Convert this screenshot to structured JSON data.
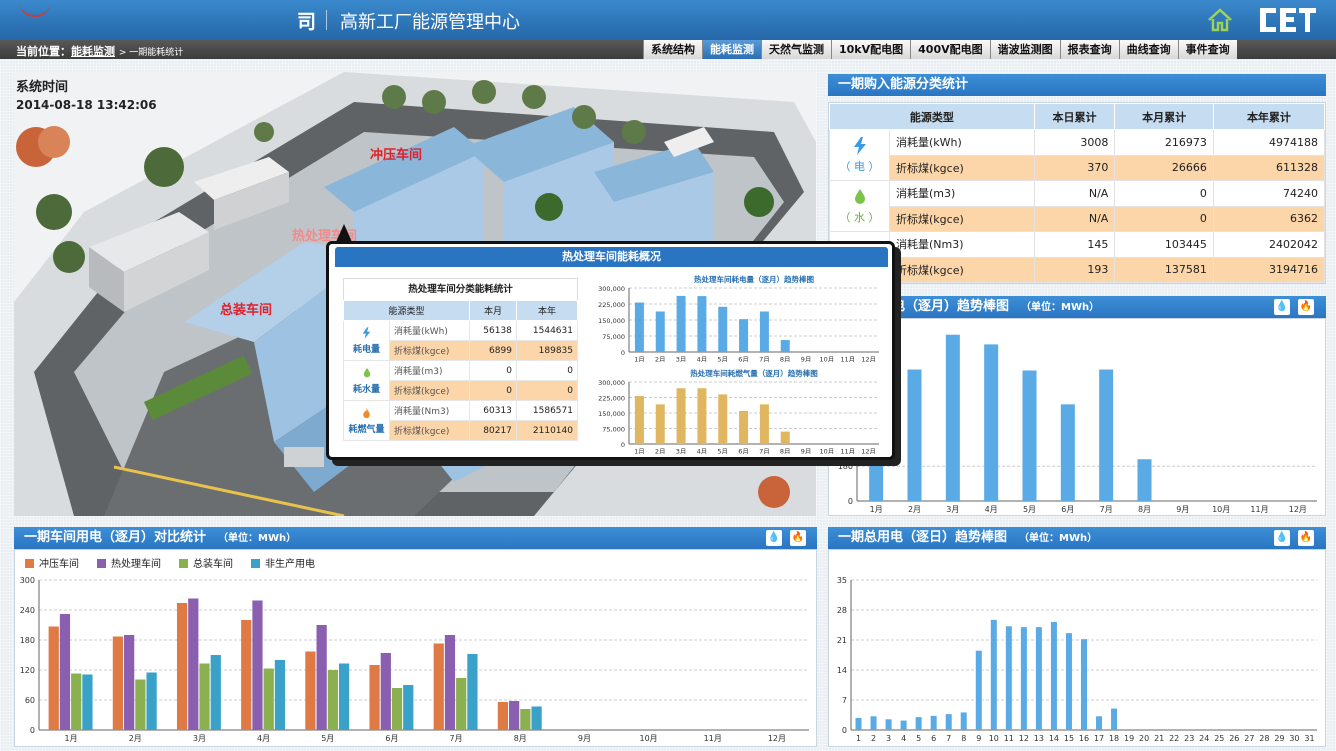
{
  "header": {
    "org_logo_text": "司",
    "title": "高新工厂能源管理中心",
    "home_icon": "home-icon",
    "brand_text": "CET"
  },
  "breadcrumb": {
    "prefix": "当前位置：",
    "current": "能耗监测",
    "sub": "> 一期能耗统计"
  },
  "menu": [
    "系统结构",
    "能耗监测",
    "天然气监测",
    "10kV配电图",
    "400V配电图",
    "谐波监测图",
    "报表查询",
    "曲线查询",
    "事件查询"
  ],
  "menu_active": "能耗监测",
  "system": {
    "label": "系统时间",
    "time": "2014-08-18  13:42:06"
  },
  "workshops": {
    "stamping": "冲压车间",
    "heat": "热处理车间",
    "assembly": "总装车间"
  },
  "energy_panel": {
    "title": "一期购入能源分类统计",
    "columns": [
      "能源类型",
      "本日累计",
      "本月累计",
      "本年累计"
    ],
    "groups": [
      {
        "label": "（ 电 ）",
        "icon": "lightning-icon",
        "rows": [
          {
            "metric": "消耗量(kWh)",
            "day": "3008",
            "month": "216973",
            "year": "4974188"
          },
          {
            "metric": "折标煤(kgce)",
            "day": "370",
            "month": "26666",
            "year": "611328"
          }
        ]
      },
      {
        "label": "（ 水 ）",
        "icon": "water-drop-icon",
        "rows": [
          {
            "metric": "消耗量(m3)",
            "day": "N/A",
            "month": "0",
            "year": "74240"
          },
          {
            "metric": "折标煤(kgce)",
            "day": "N/A",
            "month": "0",
            "year": "6362"
          }
        ]
      },
      {
        "label": "",
        "icon": "flame-icon",
        "rows": [
          {
            "metric": "消耗量(Nm3)",
            "day": "145",
            "month": "103445",
            "year": "2402042"
          },
          {
            "metric": "折标煤(kgce)",
            "day": "193",
            "month": "137581",
            "year": "3194716"
          }
        ]
      }
    ]
  },
  "popup": {
    "title": "热处理车间能耗概况",
    "table_title": "热处理车间分类能耗统计",
    "columns": [
      "能源类型",
      "本月",
      "本年"
    ],
    "groups": [
      {
        "label": "耗电量",
        "rows": [
          {
            "metric": "消耗量(kWh)",
            "month": "56138",
            "year": "1544631"
          },
          {
            "metric": "折标煤(kgce)",
            "month": "6899",
            "year": "189835"
          }
        ]
      },
      {
        "label": "耗水量",
        "rows": [
          {
            "metric": "消耗量(m3)",
            "month": "0",
            "year": "0"
          },
          {
            "metric": "折标煤(kgce)",
            "month": "0",
            "year": "0"
          }
        ]
      },
      {
        "label": "耗燃气量",
        "rows": [
          {
            "metric": "消耗量(Nm3)",
            "month": "60313",
            "year": "1586571"
          },
          {
            "metric": "折标煤(kgce)",
            "month": "80217",
            "year": "2110140"
          }
        ]
      }
    ]
  },
  "panels": {
    "monthly_power_title": "电（逐月）趋势棒图",
    "compare_title": "一期车间用电（逐月）对比统计",
    "daily_title": "一期总用电（逐日）趋势棒图",
    "unit": "（单位：MWh）"
  },
  "colors": {
    "blue": "#5aaae6",
    "gold": "#e0b760",
    "orange": "#e07a45",
    "purple": "#8a5fb0",
    "green": "#8bb050",
    "teal": "#3aa2c8"
  },
  "chart_data": [
    {
      "type": "bar",
      "title": "热处理车间耗电量（逐月）趋势棒图",
      "categories": [
        "1月",
        "2月",
        "3月",
        "4月",
        "5月",
        "6月",
        "7月",
        "8月",
        "9月",
        "10月",
        "11月",
        "12月"
      ],
      "values": [
        232000,
        190000,
        263000,
        262000,
        212000,
        154000,
        190000,
        56000,
        0,
        0,
        0,
        0
      ],
      "ylim": [
        0,
        300000
      ],
      "yticks": [
        "0",
        "75,000",
        "150,000",
        "225,000",
        "300,000"
      ],
      "color": "blue"
    },
    {
      "type": "bar",
      "title": "热处理车间耗燃气量（逐月）趋势棒图",
      "categories": [
        "1月",
        "2月",
        "3月",
        "4月",
        "5月",
        "6月",
        "7月",
        "8月",
        "9月",
        "10月",
        "11月",
        "12月"
      ],
      "values": [
        232000,
        192000,
        270000,
        270000,
        240000,
        160000,
        192000,
        60000,
        0,
        0,
        0,
        0
      ],
      "ylim": [
        0,
        300000
      ],
      "yticks": [
        "0",
        "75,000",
        "150,000",
        "225,000",
        "300,000"
      ],
      "color": "gold"
    },
    {
      "type": "bar",
      "title": "一期总用电（逐月）趋势棒图",
      "categories": [
        "1月",
        "2月",
        "3月",
        "4月",
        "5月",
        "6月",
        "7月",
        "8月",
        "9月",
        "10月",
        "11月",
        "12月"
      ],
      "values": [
        630,
        680,
        860,
        810,
        675,
        500,
        680,
        216,
        0,
        0,
        0,
        0
      ],
      "ylim": [
        0,
        900
      ],
      "yticks": [
        "0",
        "180"
      ],
      "color": "blue"
    },
    {
      "type": "bar",
      "title": "一期车间用电（逐月）对比统计",
      "categories": [
        "1月",
        "2月",
        "3月",
        "4月",
        "5月",
        "6月",
        "7月",
        "8月",
        "9月",
        "10月",
        "11月",
        "12月"
      ],
      "series": [
        {
          "name": "冲压车间",
          "color": "orange",
          "values": [
            207,
            187,
            254,
            220,
            157,
            130,
            173,
            56,
            0,
            0,
            0,
            0
          ]
        },
        {
          "name": "热处理车间",
          "color": "purple",
          "values": [
            232,
            190,
            263,
            259,
            210,
            154,
            190,
            58,
            0,
            0,
            0,
            0
          ]
        },
        {
          "name": "总装车间",
          "color": "green",
          "values": [
            113,
            101,
            133,
            123,
            120,
            84,
            104,
            42,
            0,
            0,
            0,
            0
          ]
        },
        {
          "name": "非生产用电",
          "color": "teal",
          "values": [
            111,
            115,
            150,
            140,
            133,
            90,
            152,
            47,
            0,
            0,
            0,
            0
          ]
        }
      ],
      "ylim": [
        0,
        300
      ],
      "yticks": [
        "0",
        "60",
        "120",
        "180",
        "240",
        "300"
      ]
    },
    {
      "type": "bar",
      "title": "一期总用电（逐日）趋势棒图",
      "categories": [
        "1",
        "2",
        "3",
        "4",
        "5",
        "6",
        "7",
        "8",
        "9",
        "10",
        "11",
        "12",
        "13",
        "14",
        "15",
        "16",
        "17",
        "18",
        "19",
        "20",
        "21",
        "22",
        "23",
        "24",
        "25",
        "26",
        "27",
        "28",
        "29",
        "30",
        "31"
      ],
      "values": [
        2.8,
        3.2,
        2.5,
        2.2,
        3.0,
        3.3,
        3.7,
        4.1,
        18.5,
        25.7,
        24.2,
        24.0,
        24.0,
        25.2,
        22.6,
        21.2,
        3.2,
        5.0,
        0,
        0,
        0,
        0,
        0,
        0,
        0,
        0,
        0,
        0,
        0,
        0,
        0
      ],
      "ylim": [
        0,
        35
      ],
      "yticks": [
        "0",
        "7",
        "14",
        "21",
        "28",
        "35"
      ],
      "color": "blue"
    }
  ]
}
